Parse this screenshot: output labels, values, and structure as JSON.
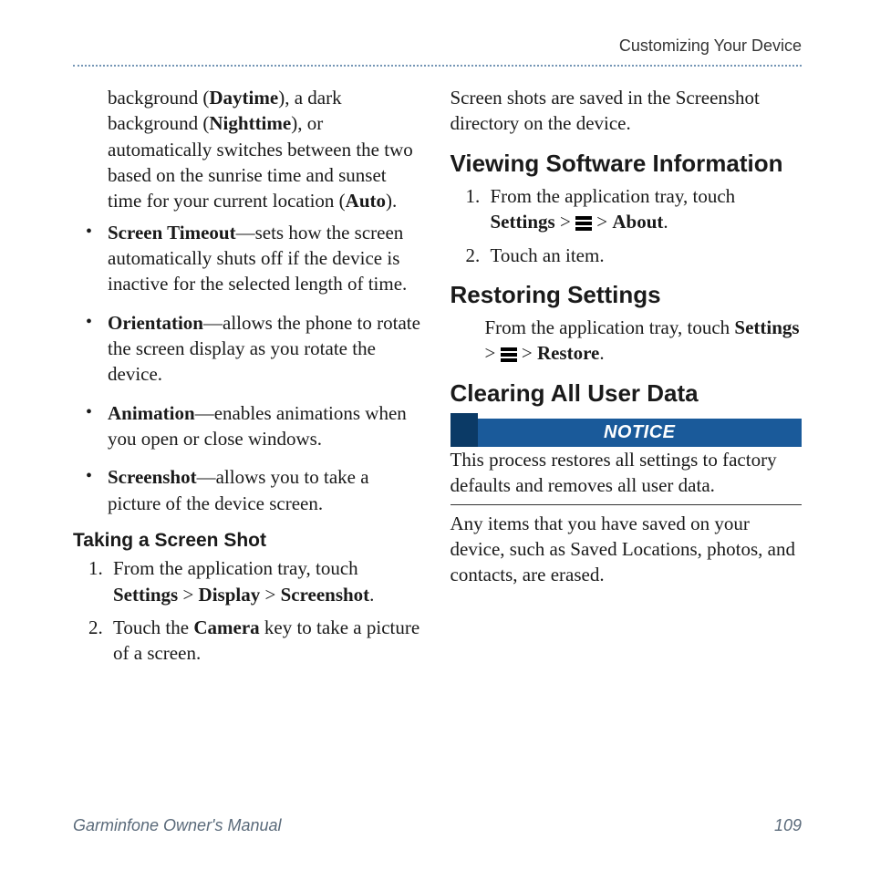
{
  "runningHead": "Customizing Your Device",
  "leftCol": {
    "continued": {
      "pre": "background (",
      "b1": "Daytime",
      "mid1": "), a dark background (",
      "b2": "Nighttime",
      "mid2": "), or automatically switches between the two based on the sunrise time and sunset time for your current location (",
      "b3": "Auto",
      "post": ")."
    },
    "bullets": [
      {
        "term": "Screen Timeout",
        "rest": "—sets how the screen automatically shuts off if the device is inactive for the selected length of time."
      },
      {
        "term": "Orientation",
        "rest": "—allows the phone to rotate the screen display as you rotate the device."
      },
      {
        "term": "Animation",
        "rest": "—enables animations when you open or close windows."
      },
      {
        "term": "Screenshot",
        "rest": "—allows you to take a picture of the device screen."
      }
    ],
    "h3": "Taking a Screen Shot",
    "step1": {
      "pre": "From the application tray, touch ",
      "b1": "Settings",
      "sep1": " > ",
      "b2": "Display",
      "sep2": " > ",
      "b3": "Screenshot",
      "post": "."
    },
    "step2": {
      "pre": "Touch the ",
      "b1": "Camera",
      "post": " key to take a picture of a screen."
    }
  },
  "rightCol": {
    "intro": "Screen shots are saved in the Screenshot directory on the device.",
    "h2a": "Viewing Software Information",
    "vs_step1": {
      "pre": "From the application tray, touch ",
      "b1": "Settings",
      "sep1": " > ",
      "sep2": " > ",
      "b2": "About",
      "post": "."
    },
    "vs_step2": "Touch an item.",
    "h2b": "Restoring Settings",
    "restore": {
      "pre": "From the application tray, touch ",
      "b1": "Settings",
      "sep1": " > ",
      "sep2": " > ",
      "b2": "Restore",
      "post": "."
    },
    "h2c": "Clearing All User Data",
    "noticeLabel": "NOTICE",
    "noticeBody": "This process restores all settings to factory defaults and removes all user data.",
    "after": "Any items that you have saved on your device, such as Saved Locations, photos, and contacts, are erased."
  },
  "footer": {
    "left": "Garminfone Owner's Manual",
    "right": "109"
  }
}
